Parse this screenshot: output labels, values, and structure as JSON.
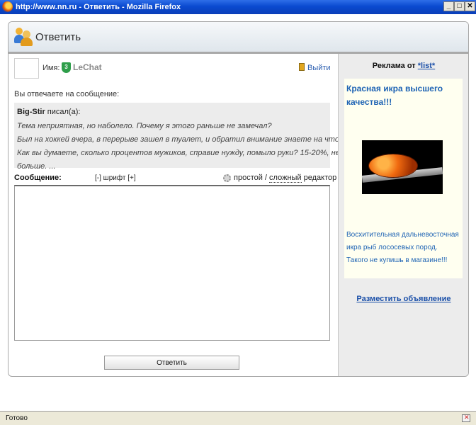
{
  "window": {
    "title": "http://www.nn.ru - Ответить - Mozilla Firefox",
    "min": "_",
    "max": "□",
    "close": "✕"
  },
  "page": {
    "title": "Ответить"
  },
  "user": {
    "name_label": "Имя:",
    "shield_level": "3",
    "username": "LeChat",
    "logout": "Выйти"
  },
  "reply": {
    "label": "Вы отвечаете на сообщение:",
    "author": "Big-Stir",
    "wrote": " писал(а):",
    "lines": [
      "Тема неприятная, но наболело. Почему я этого раньше не замечал?",
      "Был на хоккей вчера, в перерыве зашел в туалет, и обратил внимание знаете на что?",
      "Как вы думаете, сколько процентов мужиков, справие нужду, помыло руки? 15-20%, не",
      "больше. ..."
    ]
  },
  "editor": {
    "message_label": "Сообщение:",
    "font_minus": "[-]",
    "font_word": " шрифт ",
    "font_plus": "[+]",
    "simple": "простой",
    "separator": " / ",
    "advanced": "сложный",
    "editor_word": " редактор",
    "value": "",
    "submit": "Ответить"
  },
  "ad": {
    "by_label": "Реклама от ",
    "by_link": "*list*",
    "title": "Красная икра высшего качества!!!",
    "text": "Восхитительная дальневосточная икра рыб лососевых пород. Такого не купишь в магазине!!!",
    "place": "Разместить объявление"
  },
  "status": {
    "text": "Готово"
  }
}
